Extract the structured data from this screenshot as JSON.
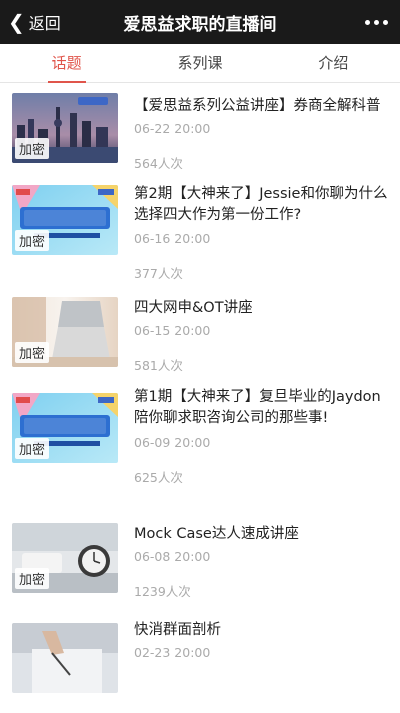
{
  "nav": {
    "back_label": "返回",
    "title": "爱思益求职的直播间"
  },
  "tabs": [
    {
      "label": "话题"
    },
    {
      "label": "系列课"
    },
    {
      "label": "介绍"
    }
  ],
  "badge_label": "加密",
  "items": [
    {
      "title": "【爱思益系列公益讲座】券商全解科普",
      "date": "06-22 20:00",
      "views": "564人次",
      "thumb": "city-skyline"
    },
    {
      "title": "第2期【大神来了】Jessie和你聊为什么选择四大作为第一份工作?",
      "date": "06-16 20:00",
      "views": "377人次",
      "thumb": "dashenlaile-banner"
    },
    {
      "title": "四大网申&OT讲座",
      "date": "06-15 20:00",
      "views": "581人次",
      "thumb": "laptop-desk"
    },
    {
      "title": "第1期【大神来了】复旦毕业的Jaydon陪你聊求职咨询公司的那些事!",
      "date": "06-09 20:00",
      "views": "625人次",
      "thumb": "dashenlaile-banner"
    },
    {
      "title": "Mock Case达人速成讲座",
      "date": "06-08 20:00",
      "views": "1239人次",
      "thumb": "alarm-clock"
    },
    {
      "title": "快消群面剖析",
      "date": "02-23 20:00",
      "views": "",
      "thumb": "writing-hand"
    }
  ],
  "colors": {
    "accent": "#e0554b",
    "navbar": "#1a1a1a"
  }
}
